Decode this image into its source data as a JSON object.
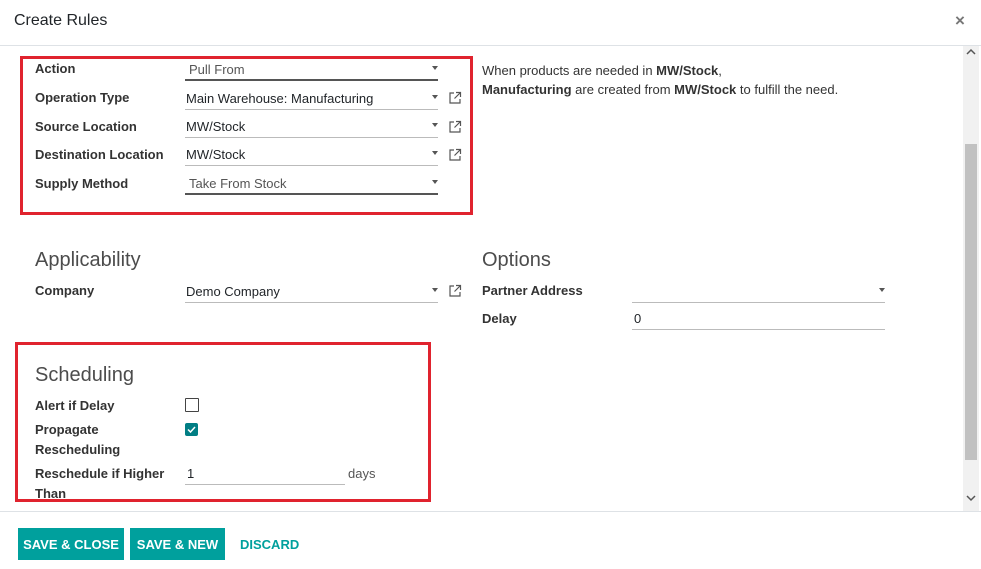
{
  "dialog": {
    "title": "Create Rules",
    "close_symbol": "×"
  },
  "rule": {
    "action": {
      "label": "Action",
      "value": "Pull From"
    },
    "operation_type": {
      "label": "Operation Type",
      "value": "Main Warehouse: Manufacturing"
    },
    "source_location": {
      "label": "Source Location",
      "value": "MW/Stock"
    },
    "destination_location": {
      "label": "Destination Location",
      "value": "MW/Stock"
    },
    "supply_method": {
      "label": "Supply Method",
      "value": "Take From Stock"
    }
  },
  "info": {
    "line1_pre": "When products are needed in ",
    "line1_bold": "MW/Stock",
    "line1_post": ",",
    "line2_bold1": "Manufacturing",
    "line2_mid": " are created from ",
    "line2_bold2": "MW/Stock",
    "line2_post": " to fulfill the need."
  },
  "applicability": {
    "title": "Applicability",
    "company": {
      "label": "Company",
      "value": "Demo Company"
    }
  },
  "options": {
    "title": "Options",
    "partner_address": {
      "label": "Partner Address",
      "value": ""
    },
    "delay": {
      "label": "Delay",
      "value": "0"
    }
  },
  "scheduling": {
    "title": "Scheduling",
    "alert_if_delay": {
      "label": "Alert if Delay",
      "checked": false
    },
    "propagate_rescheduling": {
      "label_line1": "Propagate",
      "label_line2": "Rescheduling",
      "checked": true
    },
    "reschedule_if_higher": {
      "label_line1": "Reschedule if Higher",
      "label_line2": "Than",
      "value": "1",
      "unit": "days"
    }
  },
  "footer": {
    "save_close": "SAVE & CLOSE",
    "save_new": "SAVE & NEW",
    "discard": "DISCARD"
  },
  "colors": {
    "accent": "#00a09d",
    "checkbox": "#017e84",
    "highlight": "#e0232e"
  },
  "icons": [
    "close-icon",
    "caret-down-icon",
    "external-link-icon",
    "check-icon",
    "scroll-up-icon",
    "scroll-down-icon"
  ]
}
